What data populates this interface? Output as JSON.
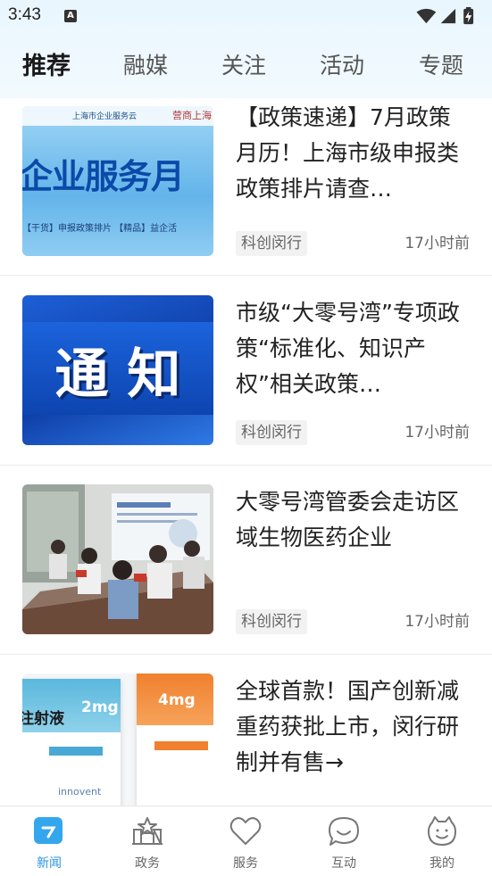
{
  "status_bar": {
    "time": "3:43",
    "notification_icon": "a-badge-icon",
    "icons": [
      "wifi-icon",
      "signal-icon",
      "battery-charging-icon"
    ]
  },
  "tabs": [
    {
      "label": "推荐",
      "active": true
    },
    {
      "label": "融媒",
      "active": false
    },
    {
      "label": "关注",
      "active": false
    },
    {
      "label": "活动",
      "active": false
    },
    {
      "label": "专题",
      "active": false
    }
  ],
  "articles": [
    {
      "title": "【政策速递】7月政策月历！上海市级申报类政策排片请查…",
      "source": "科创闵行",
      "time": "17小时前",
      "thumb": {
        "kind": "banner",
        "header": "上海市企业服务云",
        "stamp": "营商上海",
        "big_text": "企业服务月",
        "sub_text": "【干货】申报政策排片 【精品】益企活"
      }
    },
    {
      "title": "市级“大零号湾”专项政策“标准化、知识产权”相关政策…",
      "source": "科创闵行",
      "time": "17小时前",
      "thumb": {
        "kind": "notice",
        "big_text": "通 知"
      }
    },
    {
      "title": "大零号湾管委会走访区域生物医药企业",
      "source": "科创闵行",
      "time": "17小时前",
      "thumb": {
        "kind": "meeting-photo"
      }
    },
    {
      "title": "全球首款！国产创新减重药获批上市，闵行研制并有售→",
      "source": "科创闵行",
      "time": "17小时前",
      "thumb": {
        "kind": "product-photo",
        "label_left": "注射液",
        "dose_left": "2mg",
        "dose_right": "4mg",
        "brand": "innovent"
      }
    }
  ],
  "bottom_nav": [
    {
      "label": "新闻",
      "icon": "news-icon",
      "active": true
    },
    {
      "label": "政务",
      "icon": "government-icon",
      "active": false
    },
    {
      "label": "服务",
      "icon": "heart-icon",
      "active": false
    },
    {
      "label": "互动",
      "icon": "chat-bubble-icon",
      "active": false
    },
    {
      "label": "我的",
      "icon": "smiley-profile-icon",
      "active": false
    }
  ],
  "colors": {
    "accent": "#2a94e6",
    "header_bg": "#e9f6fe",
    "text": "#222222",
    "muted": "#666666"
  }
}
